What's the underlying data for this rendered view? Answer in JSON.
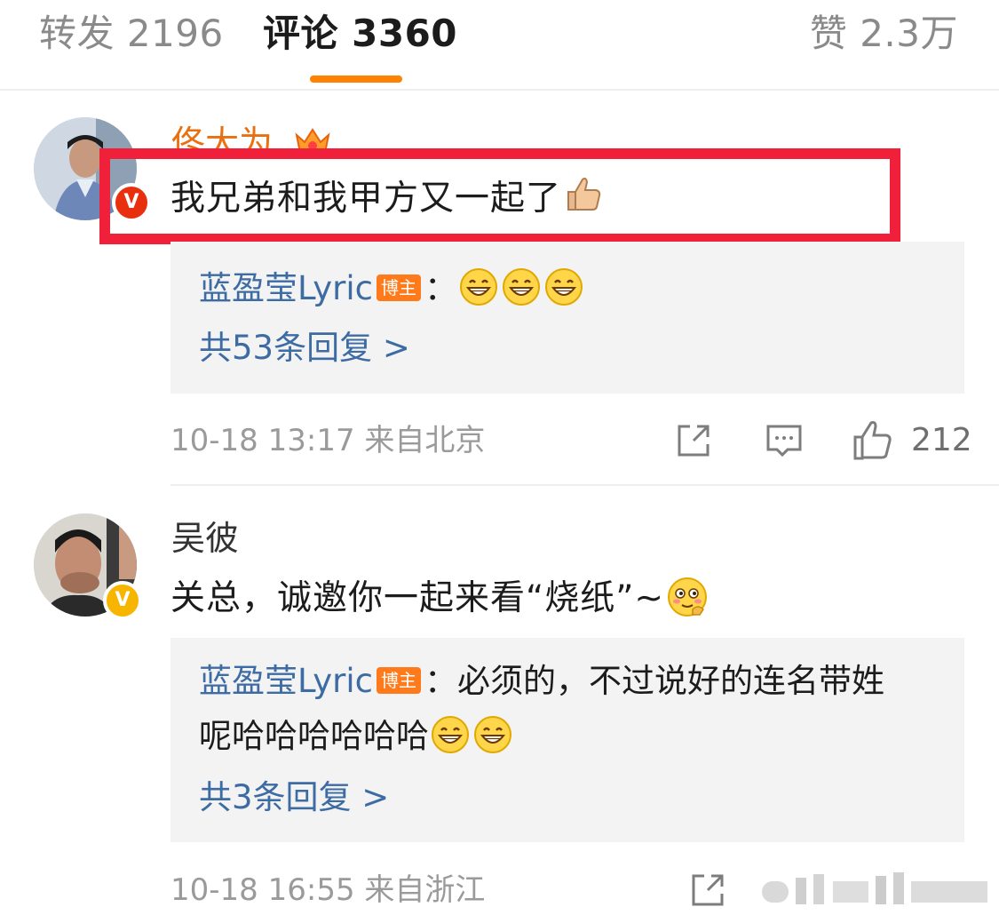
{
  "tabs": {
    "repost": "转发 2196",
    "comment": "评论 3360",
    "like": "赞 2.3万"
  },
  "comments": [
    {
      "username": "佟大为",
      "badge": "V",
      "text": "我兄弟和我甲方又一起了",
      "reply": {
        "author": "蓝盈莹Lyric",
        "tag": "博主",
        "sep": "：",
        "text_line1": "",
        "text_line2": ""
      },
      "more_replies": "共53条回复 >",
      "time": "10-18 13:17",
      "location": "来自北京",
      "likes": "212"
    },
    {
      "username": "吴彼",
      "badge": "V",
      "text": "关总，诚邀你一起来看“烧纸”~",
      "reply": {
        "author": "蓝盈莹Lyric",
        "tag": "博主",
        "sep": "：",
        "text_line1": "必须的，不过说好的连名带姓",
        "text_line2": "呢哈哈哈哈哈哈"
      },
      "more_replies": "共3条回复 >",
      "time": "10-18 16:55",
      "location": "来自浙江",
      "likes": ""
    }
  ],
  "colors": {
    "accent": "#ff8200",
    "link_blue": "#3d6ba3",
    "highlight_red": "#f0203a",
    "username_orange": "#ea6f10"
  },
  "icons": [
    "crown-icon",
    "thumbs-up-emoji",
    "grin-emoji",
    "blush-emoji",
    "share-icon",
    "comment-icon",
    "like-icon",
    "verified-badge-icon"
  ]
}
